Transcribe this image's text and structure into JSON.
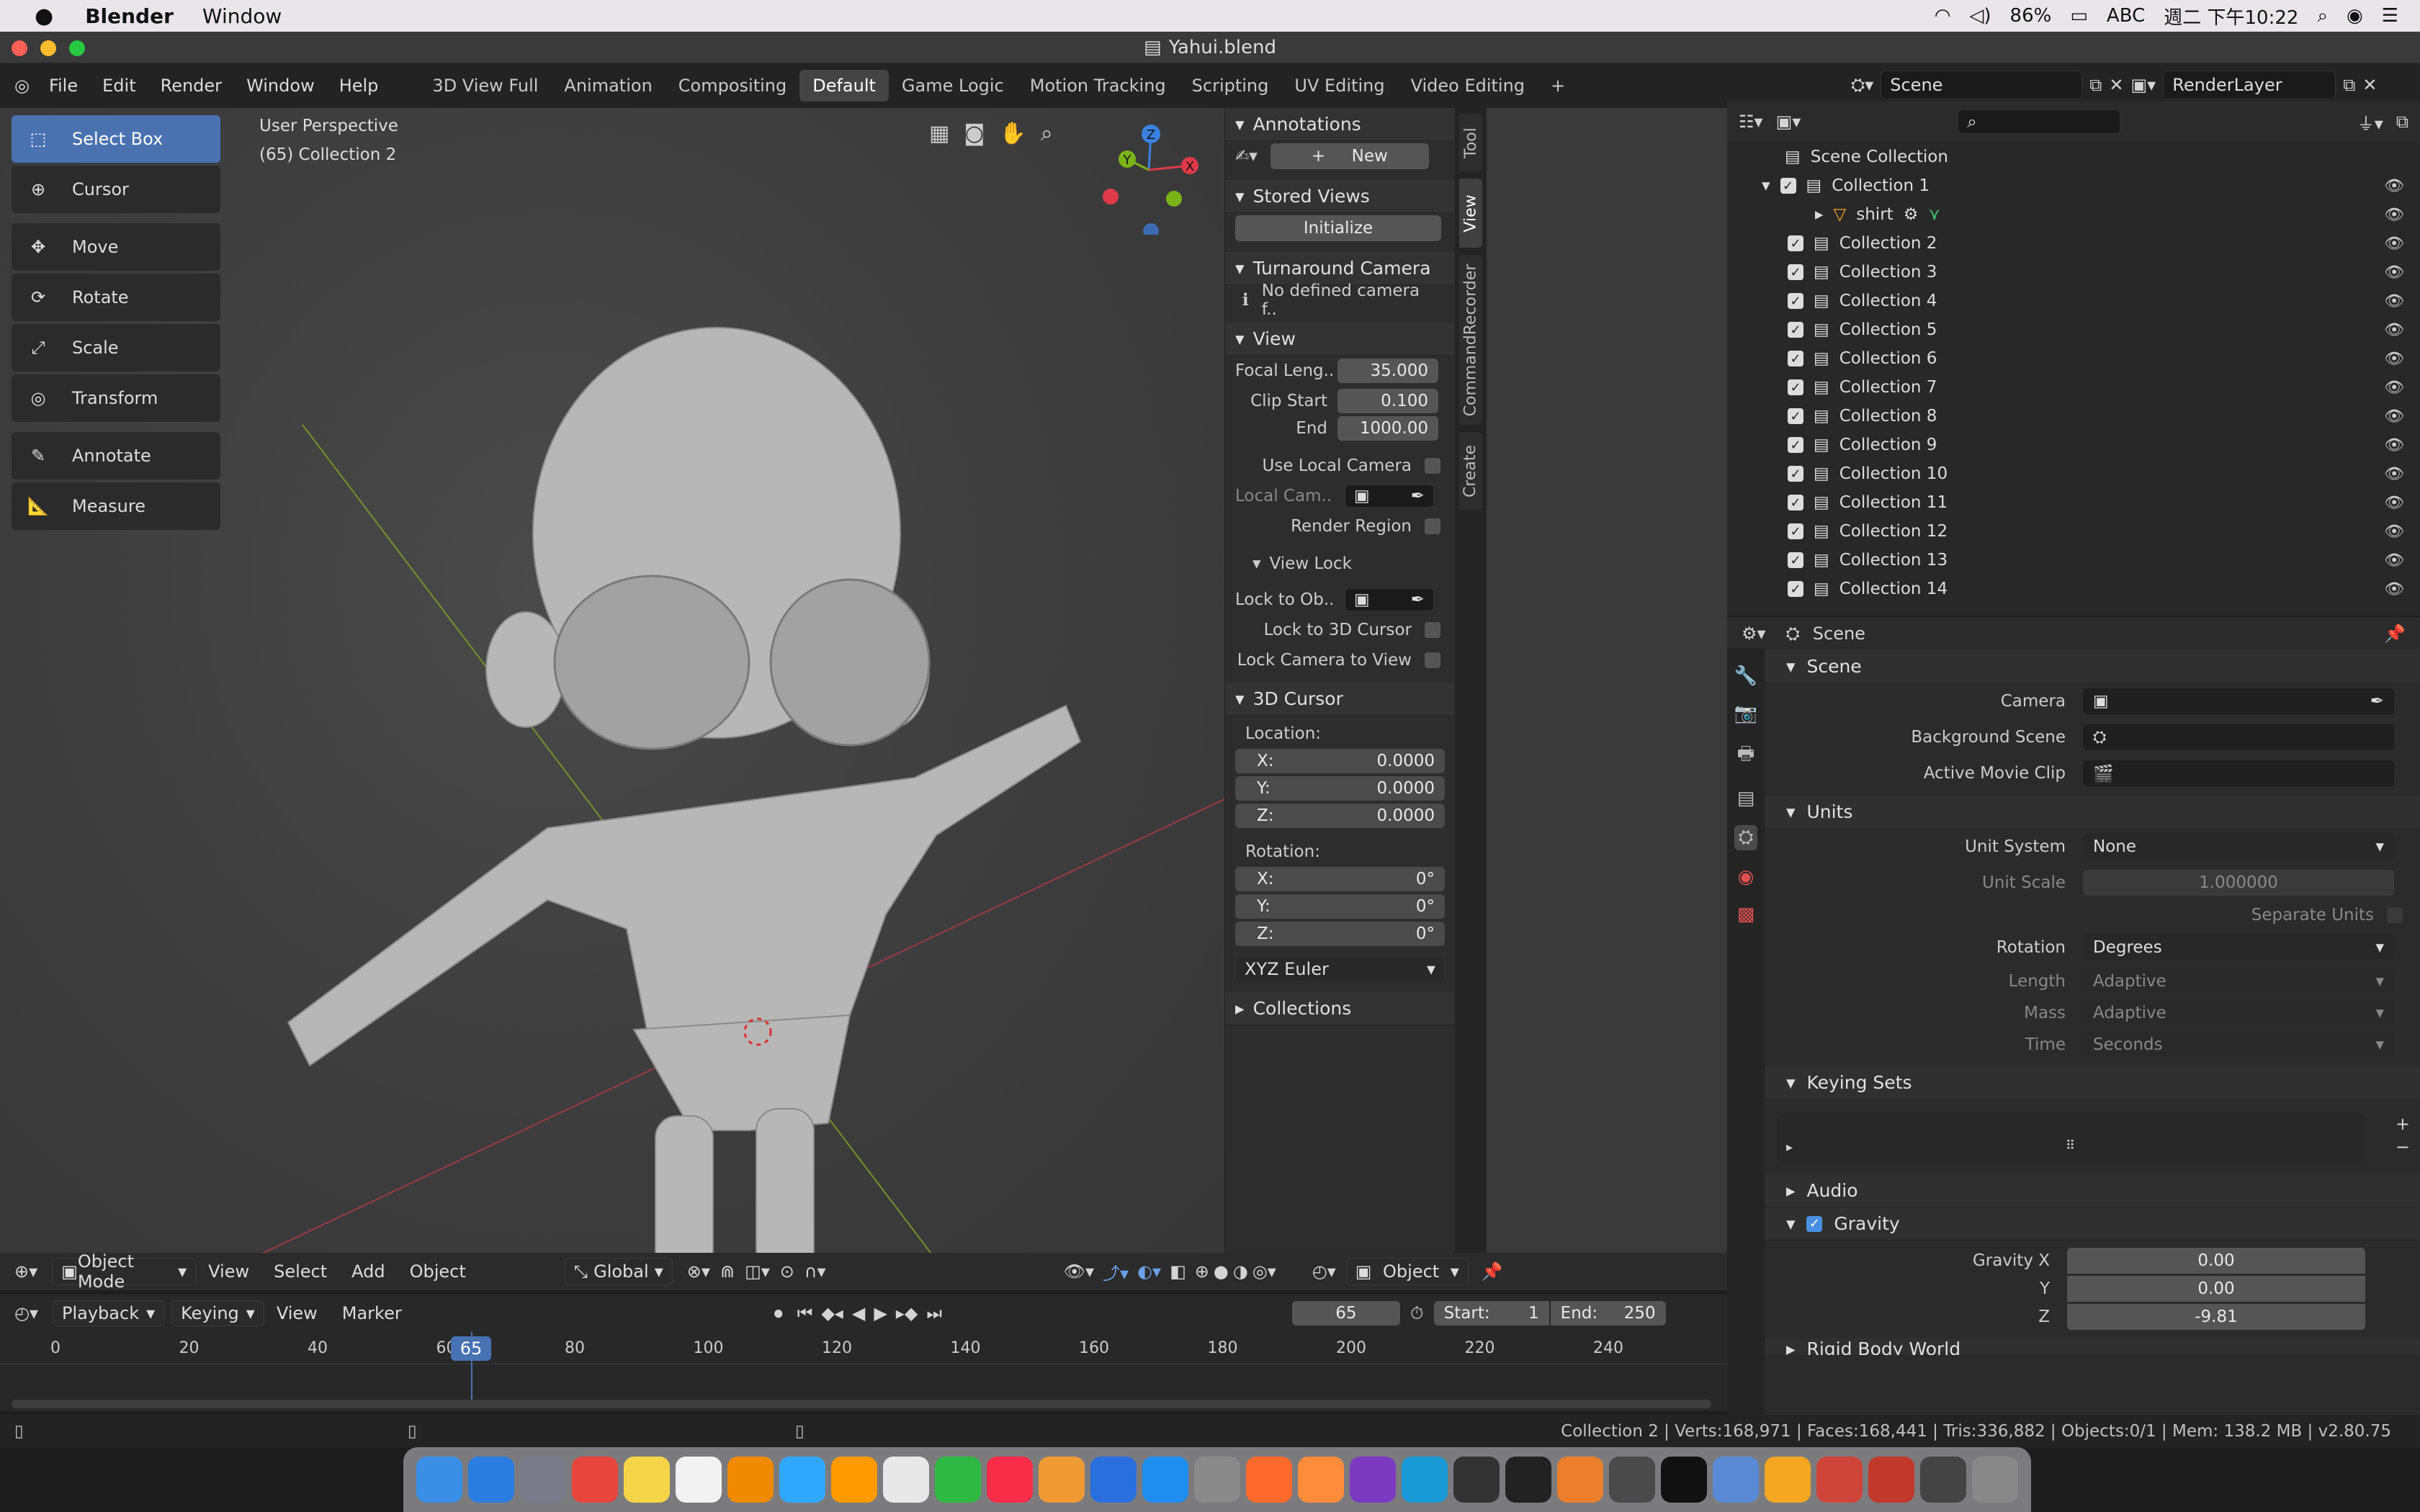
{
  "mac": {
    "app": "Blender",
    "menu": "Window",
    "battery": "86%",
    "ime": "ABC",
    "clock": "週二 下午10:22"
  },
  "window": {
    "title": "Yahui.blend"
  },
  "topbar": {
    "menus": [
      "File",
      "Edit",
      "Render",
      "Window",
      "Help"
    ],
    "workspaces": [
      "3D View Full",
      "Animation",
      "Compositing",
      "Default",
      "Game Logic",
      "Motion Tracking",
      "Scripting",
      "UV Editing",
      "Video Editing"
    ],
    "active_workspace": "Default",
    "scene": "Scene",
    "render_layer": "RenderLayer"
  },
  "viewport": {
    "perspective": "User Perspective",
    "collection": "(65) Collection 2"
  },
  "tools": [
    "Select Box",
    "Cursor",
    "Move",
    "Rotate",
    "Scale",
    "Transform",
    "Annotate",
    "Measure"
  ],
  "npanel": {
    "annotations": "Annotations",
    "new": "New",
    "stored_views": "Stored Views",
    "initialize": "Initialize",
    "turnaround": "Turnaround Camera",
    "no_camera": "No defined camera f..",
    "view": "View",
    "focal_label": "Focal Leng..",
    "focal": "35.000",
    "clip_start_label": "Clip Start",
    "clip_start": "0.100",
    "end_label": "End",
    "clip_end": "1000.00",
    "use_local_camera": "Use Local Camera",
    "local_cam": "Local Cam..",
    "render_region": "Render Region",
    "view_lock": "View Lock",
    "lock_to_ob": "Lock to Ob..",
    "lock_cursor": "Lock to 3D Cursor",
    "lock_cam": "Lock Camera to View",
    "cursor": "3D Cursor",
    "location": "Location:",
    "rotation": "Rotation:",
    "x": "X:",
    "y": "Y:",
    "z": "Z:",
    "loc_x": "0.0000",
    "loc_y": "0.0000",
    "loc_z": "0.0000",
    "rot_x": "0°",
    "rot_y": "0°",
    "rot_z": "0°",
    "euler": "XYZ Euler",
    "collections": "Collections",
    "tabs": [
      "Tool",
      "View",
      "CommandRecorder",
      "Create"
    ]
  },
  "outliner": {
    "root": "Scene Collection",
    "collection1": "Collection 1",
    "shirt": "shirt",
    "collections": [
      "Collection 2",
      "Collection 3",
      "Collection 4",
      "Collection 5",
      "Collection 6",
      "Collection 7",
      "Collection 8",
      "Collection 9",
      "Collection 10",
      "Collection 11",
      "Collection 12",
      "Collection 13",
      "Collection 14"
    ]
  },
  "props": {
    "context": "Scene",
    "scene_section": "Scene",
    "camera": "Camera",
    "bg_scene": "Background Scene",
    "movie_clip": "Active Movie Clip",
    "units": "Units",
    "unit_system_label": "Unit System",
    "unit_system": "None",
    "unit_scale_label": "Unit Scale",
    "unit_scale": "1.000000",
    "separate_units": "Separate Units",
    "rotation_label": "Rotation",
    "rotation": "Degrees",
    "length_label": "Length",
    "length": "Adaptive",
    "mass_label": "Mass",
    "mass": "Adaptive",
    "time_label": "Time",
    "time": "Seconds",
    "keying_sets": "Keying Sets",
    "audio": "Audio",
    "gravity": "Gravity",
    "gx_label": "Gravity X",
    "gy_label": "Y",
    "gz_label": "Z",
    "gx": "0.00",
    "gy": "0.00",
    "gz": "-9.81",
    "rigid": "Rigid Body World"
  },
  "vphead": {
    "mode": "Object Mode",
    "view": "View",
    "select": "Select",
    "add": "Add",
    "object": "Object",
    "orientation": "Global",
    "obj_type": "Object"
  },
  "timeline": {
    "playback": "Playback",
    "keying": "Keying",
    "view": "View",
    "marker": "Marker",
    "current": "65",
    "start_label": "Start:",
    "start": "1",
    "end_label": "End:",
    "end": "250",
    "ticks": [
      "0",
      "20",
      "40",
      "60",
      "80",
      "100",
      "120",
      "140",
      "160",
      "180",
      "200",
      "220",
      "240"
    ]
  },
  "status": {
    "text": "Collection 2 | Verts:168,971 | Faces:168,441 | Tris:336,882 | Objects:0/1 | Mem: 138.2 MB | v2.80.75"
  },
  "dock": [
    "Finder",
    "Safari",
    "Launchpad",
    "Chrome",
    "Notes",
    "Calendar",
    "VLC",
    "Ps",
    "Ai",
    "Photos",
    "Messages",
    "Music",
    "Pages",
    "Keynote",
    "App Store",
    "System Preferences",
    "Firefox",
    "Sublime",
    "OneNote",
    "Edge",
    "Unity",
    "Terminal",
    "Blender",
    "Final Cut",
    "Live",
    "Preview",
    "Infuse",
    "Git",
    "Pencil",
    "Phone",
    "Trash"
  ],
  "colors": {
    "accent": "#4a72b0",
    "active_frame": "#4772b3"
  }
}
